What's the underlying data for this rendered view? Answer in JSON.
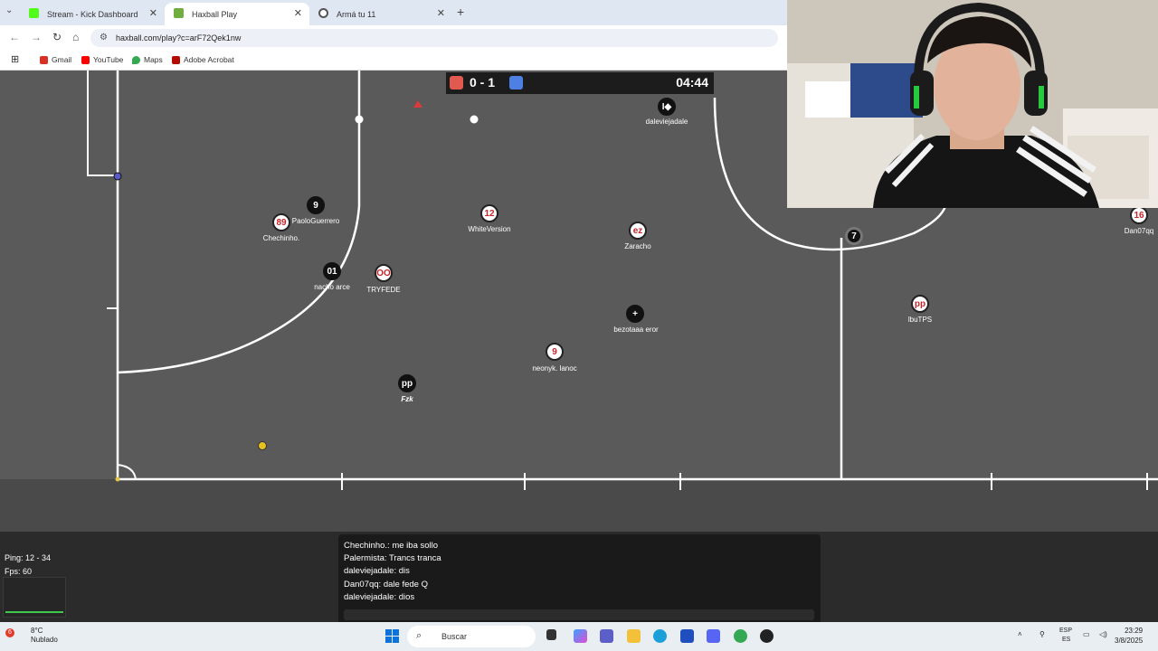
{
  "browser": {
    "tabs": [
      {
        "label": "Stream - Kick Dashboard",
        "icon": "kick-icon",
        "color": "#53fc18"
      },
      {
        "label": "Haxball Play",
        "icon": "haxball-icon",
        "color": "#6fae3f"
      },
      {
        "label": "Armá tu 11",
        "icon": "soccer-ball-icon",
        "color": "#555555"
      }
    ],
    "url": "haxball.com/play?c=arF72Qek1nw",
    "bookmarks": [
      {
        "label": "Gmail",
        "icon": "gmail-icon",
        "color": "#d93025"
      },
      {
        "label": "YouTube",
        "icon": "youtube-icon",
        "color": "#ff0000"
      },
      {
        "label": "Maps",
        "icon": "maps-icon",
        "color": "#34a853"
      },
      {
        "label": "Adobe Acrobat",
        "icon": "acrobat-icon",
        "color": "#b30b00"
      }
    ]
  },
  "scoreboard": {
    "score": "0 - 1",
    "time": "04:44",
    "red_color": "#e25a4f",
    "blue_color": "#4e7fe2"
  },
  "players": [
    {
      "number": "89",
      "name": "Chechinho.",
      "team": "red"
    },
    {
      "number": "9",
      "name": "PaoloGuerrero",
      "team": "blue"
    },
    {
      "number": "12",
      "name": "WhiteVersion",
      "team": "red"
    },
    {
      "number": "ez",
      "name": "Zaracho",
      "team": "red"
    },
    {
      "number": "01",
      "name": "nacho arce",
      "team": "blue"
    },
    {
      "number": "OO",
      "name": "TRYFEDE",
      "team": "red"
    },
    {
      "number": "+",
      "name": "bezotaaa eror",
      "team": "blue"
    },
    {
      "number": "9",
      "name": "neonyk. lanoc",
      "team": "red"
    },
    {
      "number": "pp",
      "name": "Fzk",
      "team": "blue"
    },
    {
      "number": "pp",
      "name": "lbuTPS",
      "team": "red"
    },
    {
      "number": "16",
      "name": "Dan07qq",
      "team": "red"
    },
    {
      "number": "7",
      "name": "",
      "team": "blue"
    },
    {
      "number": "I◆",
      "name": "daleviejadale",
      "team": "blue"
    }
  ],
  "stats": {
    "ping": "Ping: 12 - 34",
    "fps": "Fps: 60"
  },
  "chat": [
    "Chechinho.: me iba sollo",
    "Palermista: Trancs tranca",
    "daleviejadale: dis",
    "Dan07qq: dale fede Q",
    "daleviejadale: dios"
  ],
  "taskbar": {
    "weather_temp": "8°C",
    "weather_desc": "Nublado",
    "weather_badge": "6",
    "search_placeholder": "Buscar",
    "lang_top": "ESP",
    "lang_bottom": "ES",
    "time": "23:29",
    "date": "3/8/2025"
  }
}
